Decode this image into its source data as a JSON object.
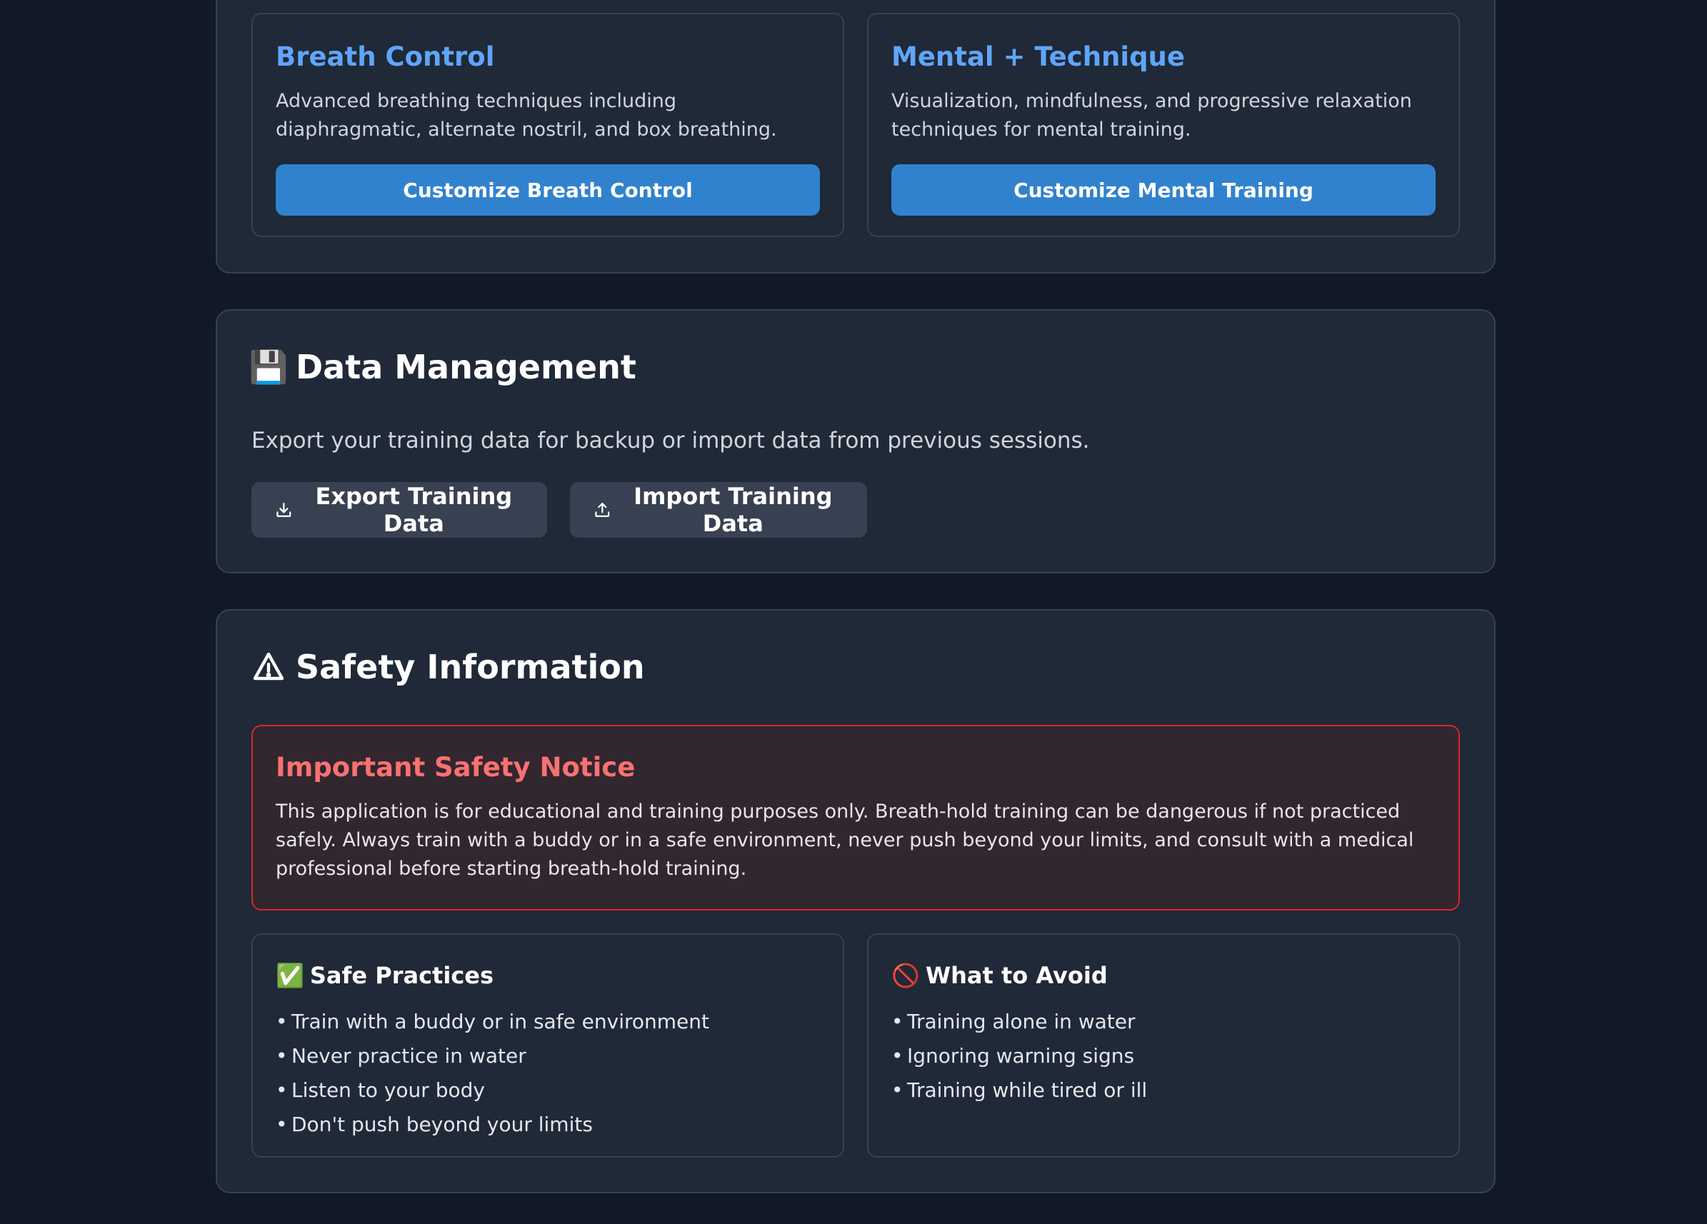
{
  "technique_cards": [
    {
      "title": "Breath Control",
      "description": "Advanced breathing techniques including diaphragmatic, alternate nostril, and box breathing.",
      "button_label": "Customize Breath Control"
    },
    {
      "title": "Mental + Technique",
      "description": "Visualization, mindfulness, and progressive relaxation techniques for mental training.",
      "button_label": "Customize Mental Training"
    }
  ],
  "data_management": {
    "icon": "floppy-disk-icon",
    "emoji": "💾",
    "title": "Data Management",
    "description": "Export your training data for backup or import data from previous sessions.",
    "export_label": "Export Training Data",
    "import_label": "Import Training Data"
  },
  "safety": {
    "icon": "warning-icon",
    "title": "Safety Information",
    "notice": {
      "title": "Important Safety Notice",
      "text": "This application is for educational and training purposes only. Breath-hold training can be dangerous if not practiced safely. Always train with a buddy or in a safe environment, never push beyond your limits, and consult with a medical professional before starting breath-hold training."
    },
    "safe_practices": {
      "emoji": "✅",
      "title": "Safe Practices",
      "items": [
        "Train with a buddy or in safe environment",
        "Never practice in water",
        "Listen to your body",
        "Don't push beyond your limits"
      ]
    },
    "what_to_avoid": {
      "emoji": "🚫",
      "title": "What to Avoid",
      "items": [
        "Training alone in water",
        "Ignoring warning signs",
        "Training while tired or ill"
      ]
    }
  },
  "colors": {
    "background": "#111827",
    "panel": "#1f2937",
    "accent": "#3182ce",
    "card_title": "#60a5fa",
    "danger": "#dc2626",
    "danger_text": "#f87171"
  }
}
